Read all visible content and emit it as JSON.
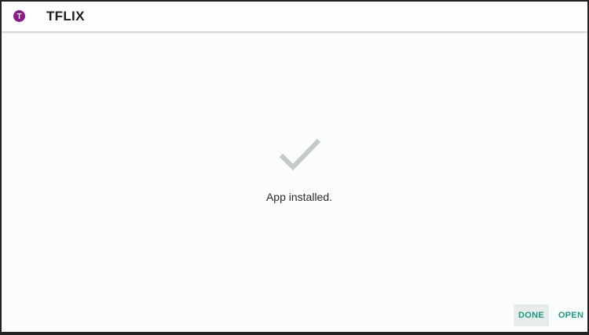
{
  "appbar": {
    "title": "TFLIX",
    "icon": "tflix-app-icon",
    "icon_letter": "T",
    "icon_color": "#8a1a8d"
  },
  "main": {
    "status_icon": "checkmark-icon",
    "status_text": "App installed."
  },
  "actions": {
    "done_label": "DONE",
    "open_label": "OPEN",
    "accent_color": "#1c9a82"
  }
}
